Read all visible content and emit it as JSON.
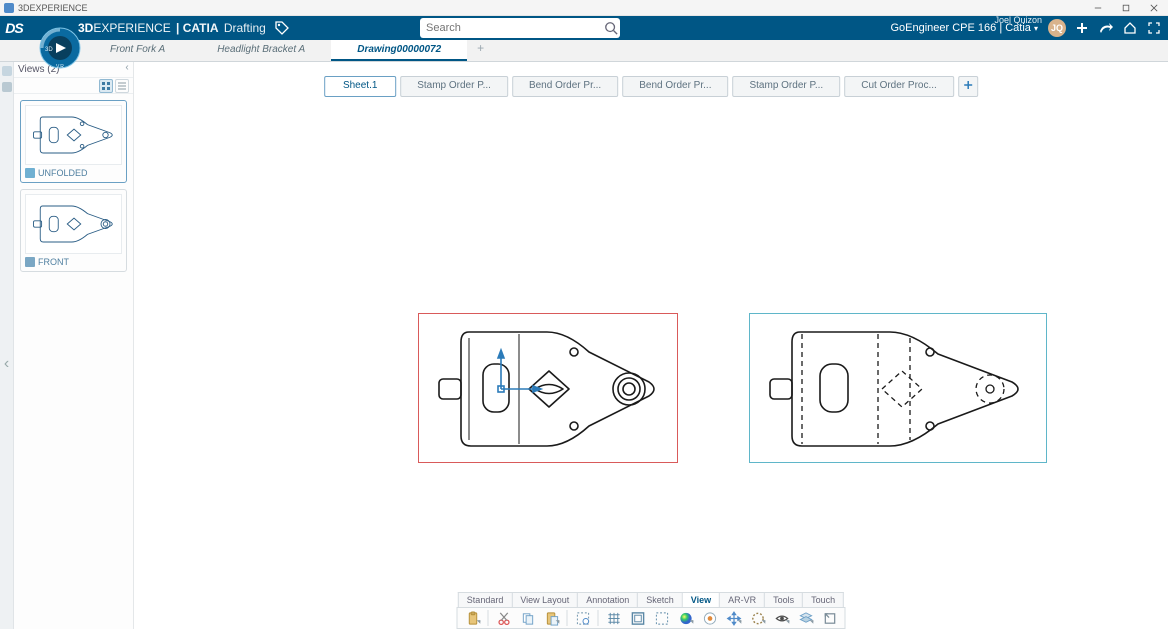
{
  "os": {
    "title": "3DEXPERIENCE"
  },
  "brand": {
    "bold1": "3D",
    "rest1": "EXPERIENCE",
    "bold2": " | CATIA",
    "rest2": " Drafting",
    "logo": "DS"
  },
  "search": {
    "placeholder": "Search"
  },
  "user": {
    "name": "Joel Quizon",
    "credit": "GoEngineer CPE 166 | Catia",
    "avatar": "JQ"
  },
  "doc_tabs": {
    "items": [
      {
        "label": "Front Fork A"
      },
      {
        "label": "Headlight Bracket A"
      },
      {
        "label": "Drawing00000072",
        "active": true
      }
    ],
    "add": "+"
  },
  "side": {
    "title": "Views (2)",
    "thumbs": [
      {
        "label": "UNFOLDED"
      },
      {
        "label": "FRONT"
      }
    ]
  },
  "sheets": {
    "items": [
      {
        "label": "Sheet.1",
        "active": true
      },
      {
        "label": "Stamp Order P..."
      },
      {
        "label": "Bend Order Pr..."
      },
      {
        "label": "Bend Order Pr..."
      },
      {
        "label": "Stamp Order P..."
      },
      {
        "label": "Cut Order Proc..."
      }
    ]
  },
  "bottom_tabs": {
    "items": [
      {
        "label": "Standard"
      },
      {
        "label": "View Layout"
      },
      {
        "label": "Annotation"
      },
      {
        "label": "Sketch"
      },
      {
        "label": "View",
        "active": true
      },
      {
        "label": "AR-VR"
      },
      {
        "label": "Tools"
      },
      {
        "label": "Touch"
      }
    ]
  },
  "toolbar_icons": {
    "names": [
      "clipboard",
      "cut",
      "copy",
      "paste",
      "capture",
      "grid",
      "frame",
      "rect-select",
      "shading",
      "precision",
      "arrows",
      "view-hidden",
      "eye",
      "layers",
      "expand"
    ]
  }
}
